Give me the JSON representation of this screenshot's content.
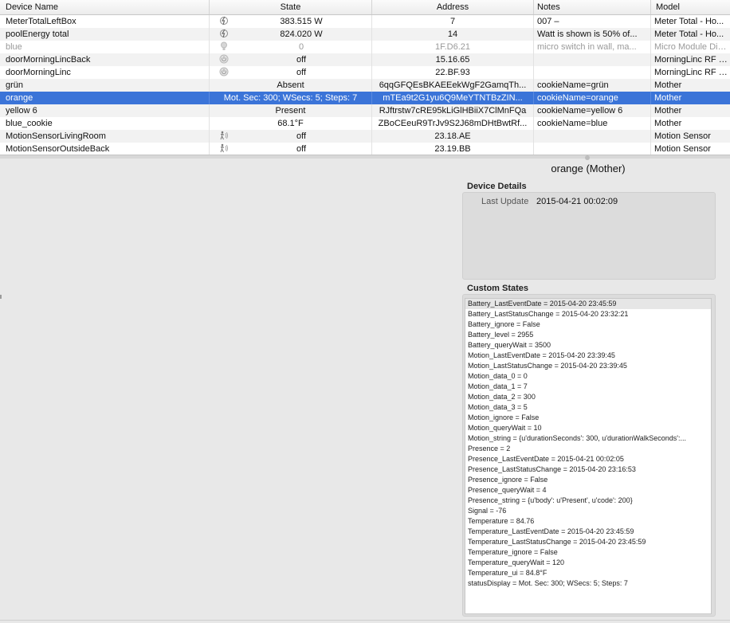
{
  "columns": {
    "name": "Device Name",
    "state": "State",
    "address": "Address",
    "notes": "Notes",
    "model": "Model"
  },
  "devices": [
    {
      "name": "MeterTotalLeftBox",
      "icon": "energy-meter-icon",
      "state": "383.515 W",
      "address": "7",
      "notes": "007 –",
      "model": "Meter Total - Ho..."
    },
    {
      "name": "poolEnergy total",
      "icon": "energy-meter-icon",
      "state": "824.020 W",
      "address": "14",
      "notes": "Watt is shown is 50% of...",
      "model": "Meter Total - Ho..."
    },
    {
      "name": "blue",
      "icon": "lightbulb-icon",
      "state": "0",
      "address": "1F.D6.21",
      "notes": "micro switch in wall, ma...",
      "model": "Micro Module Dim..."
    },
    {
      "name": "doorMorningLincBack",
      "icon": "power-icon",
      "state": "off",
      "address": "15.16.65",
      "notes": "",
      "model": "MorningLinc RF C..."
    },
    {
      "name": "doorMorningLinc",
      "icon": "power-icon",
      "state": "off",
      "address": "22.BF.93",
      "notes": "",
      "model": "MorningLinc RF C..."
    },
    {
      "name": "grün",
      "icon": "",
      "state": "Absent",
      "address": "6qqGFQEsBKAEEekWgF2GamqTh...",
      "notes": "cookieName=grün",
      "model": "Mother"
    },
    {
      "name": "orange",
      "icon": "",
      "state": "Mot. Sec: 300; WSecs: 5; Steps: 7",
      "address": "mTEa9t2G1yu6Q9MeYTNTBzZIN...",
      "notes": "cookieName=orange",
      "model": "Mother"
    },
    {
      "name": "yellow 6",
      "icon": "",
      "state": "Present",
      "address": "RJftrstw7cRE95kLiGlHBiiX7ClMnFQa",
      "notes": "cookieName=yellow 6",
      "model": "Mother"
    },
    {
      "name": "blue_cookie",
      "icon": "",
      "state": "68.1°F",
      "address": "ZBoCEeuR9TrJv9S2J68mDHtBwtRf...",
      "notes": "cookieName=blue",
      "model": "Mother"
    },
    {
      "name": "MotionSensorLivingRoom",
      "icon": "motion-icon",
      "state": "off",
      "address": "23.18.AE",
      "notes": "",
      "model": "Motion Sensor"
    },
    {
      "name": "MotionSensorOutsideBack",
      "icon": "motion-icon",
      "state": "off",
      "address": "23.19.BB",
      "notes": "",
      "model": "Motion Sensor"
    }
  ],
  "detail": {
    "title": "orange (Mother)",
    "device_details_label": "Device Details",
    "last_update_label": "Last Update",
    "last_update_value": "2015-04-21 00:02:09",
    "custom_states_label": "Custom States"
  },
  "custom_states": [
    "Battery_LastEventDate = 2015-04-20 23:45:59",
    "Battery_LastStatusChange = 2015-04-20 23:32:21",
    "Battery_ignore = False",
    "Battery_level = 2955",
    "Battery_queryWait = 3500",
    "Motion_LastEventDate = 2015-04-20 23:39:45",
    "Motion_LastStatusChange = 2015-04-20 23:39:45",
    "Motion_data_0 = 0",
    "Motion_data_1 = 7",
    "Motion_data_2 = 300",
    "Motion_data_3 = 5",
    "Motion_ignore = False",
    "Motion_queryWait = 10",
    "Motion_string = {u'durationSeconds': 300, u'durationWalkSeconds':...",
    "Presence = 2",
    "Presence_LastEventDate = 2015-04-21 00:02:05",
    "Presence_LastStatusChange = 2015-04-20 23:16:53",
    "Presence_ignore = False",
    "Presence_queryWait = 4",
    "Presence_string = {u'body': u'Present', u'code': 200}",
    "Signal = -76",
    "Temperature = 84.76",
    "Temperature_LastEventDate = 2015-04-20 23:45:59",
    "Temperature_LastStatusChange = 2015-04-20 23:45:59",
    "Temperature_ignore = False",
    "Temperature_queryWait = 120",
    "Temperature_ui = 84.8°F",
    "statusDisplay = Mot. Sec: 300; WSecs: 5; Steps: 7"
  ],
  "colors": {
    "selection": "#3b74d8",
    "alt_row": "#f2f2f2",
    "panel_bg": "#e8e8e8"
  },
  "selected_row_index": 6,
  "dim_row_index": 2
}
